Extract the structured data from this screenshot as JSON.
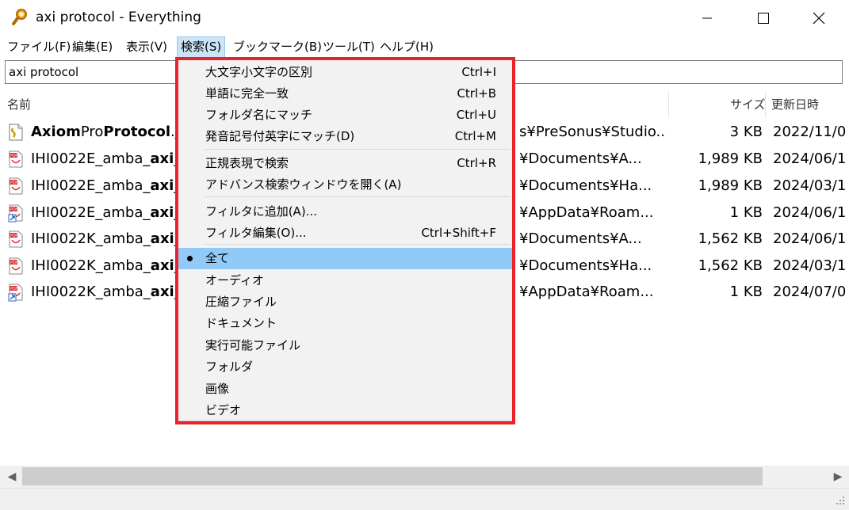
{
  "window": {
    "title": "axi protocol - Everything",
    "icon": "magnifier-icon",
    "controls": [
      "minimize-icon",
      "maximize-icon",
      "close-icon"
    ]
  },
  "menubar": {
    "items": [
      {
        "label": "ファイル(F)"
      },
      {
        "label": "編集(E)"
      },
      {
        "label": "表示(V)"
      },
      {
        "label": "検索(S)",
        "active": true
      },
      {
        "label": "ブックマーク(B)"
      },
      {
        "label": "ツール(T)"
      },
      {
        "label": "ヘルプ(H)"
      }
    ]
  },
  "search": {
    "value": "axi protocol"
  },
  "columns": {
    "name": "名前",
    "size": "サイズ",
    "date": "更新日時"
  },
  "rows": [
    {
      "icon": "script-file-icon",
      "name_parts": [
        "Axiom",
        "Pro",
        "Protocol",
        ".js"
      ],
      "path": "s¥PreSonus¥Studio...",
      "size": "3 KB",
      "date": "2022/11/0"
    },
    {
      "icon": "pdf-file-icon",
      "name_parts": [
        "IHI0022E_amba_",
        "axi",
        "_"
      ],
      "path": "¥Documents¥A...",
      "size": "1,989 KB",
      "date": "2024/06/1"
    },
    {
      "icon": "pdf-file-icon",
      "name_parts": [
        "IHI0022E_amba_",
        "axi",
        "_"
      ],
      "path": "¥Documents¥Ha...",
      "size": "1,989 KB",
      "date": "2024/03/1"
    },
    {
      "icon": "pdf-shortcut-icon",
      "name_parts": [
        "IHI0022E_amba_",
        "axi",
        "_"
      ],
      "path": "¥AppData¥Roam...",
      "size": "1 KB",
      "date": "2024/06/1"
    },
    {
      "icon": "pdf-file-icon",
      "name_parts": [
        "IHI0022K_amba_",
        "axi",
        "_"
      ],
      "path": "¥Documents¥A...",
      "size": "1,562 KB",
      "date": "2024/06/1"
    },
    {
      "icon": "pdf-file-icon",
      "name_parts": [
        "IHI0022K_amba_",
        "axi",
        "_"
      ],
      "path": "¥Documents¥Ha...",
      "size": "1,562 KB",
      "date": "2024/03/1"
    },
    {
      "icon": "pdf-shortcut-icon",
      "name_parts": [
        "IHI0022K_amba_",
        "axi",
        "_"
      ],
      "path": "¥AppData¥Roam...",
      "size": "1 KB",
      "date": "2024/07/0"
    }
  ],
  "search_menu": {
    "items": [
      {
        "label": "大文字小文字の区別",
        "shortcut": "Ctrl+I"
      },
      {
        "label": "単語に完全一致",
        "shortcut": "Ctrl+B"
      },
      {
        "label": "フォルダ名にマッチ",
        "shortcut": "Ctrl+U"
      },
      {
        "label": "発音記号付英字にマッチ(D)",
        "shortcut": "Ctrl+M"
      },
      {
        "label": "正規表現で検索",
        "shortcut": "Ctrl+R"
      },
      {
        "label": "アドバンス検索ウィンドウを開く(A)",
        "shortcut": ""
      },
      {
        "label": "フィルタに追加(A)...",
        "shortcut": ""
      },
      {
        "label": "フィルタ編集(O)...",
        "shortcut": "Ctrl+Shift+F"
      },
      {
        "label": "全て",
        "shortcut": "",
        "checked": true
      },
      {
        "label": "オーディオ",
        "shortcut": ""
      },
      {
        "label": "圧縮ファイル",
        "shortcut": ""
      },
      {
        "label": "ドキュメント",
        "shortcut": ""
      },
      {
        "label": "実行可能ファイル",
        "shortcut": ""
      },
      {
        "label": "フォルダ",
        "shortcut": ""
      },
      {
        "label": "画像",
        "shortcut": ""
      },
      {
        "label": "ビデオ",
        "shortcut": ""
      }
    ]
  },
  "colors": {
    "highlight_border": "#e8232b",
    "menu_selected": "#91c9f7",
    "menubar_active": "#cce4f7"
  }
}
